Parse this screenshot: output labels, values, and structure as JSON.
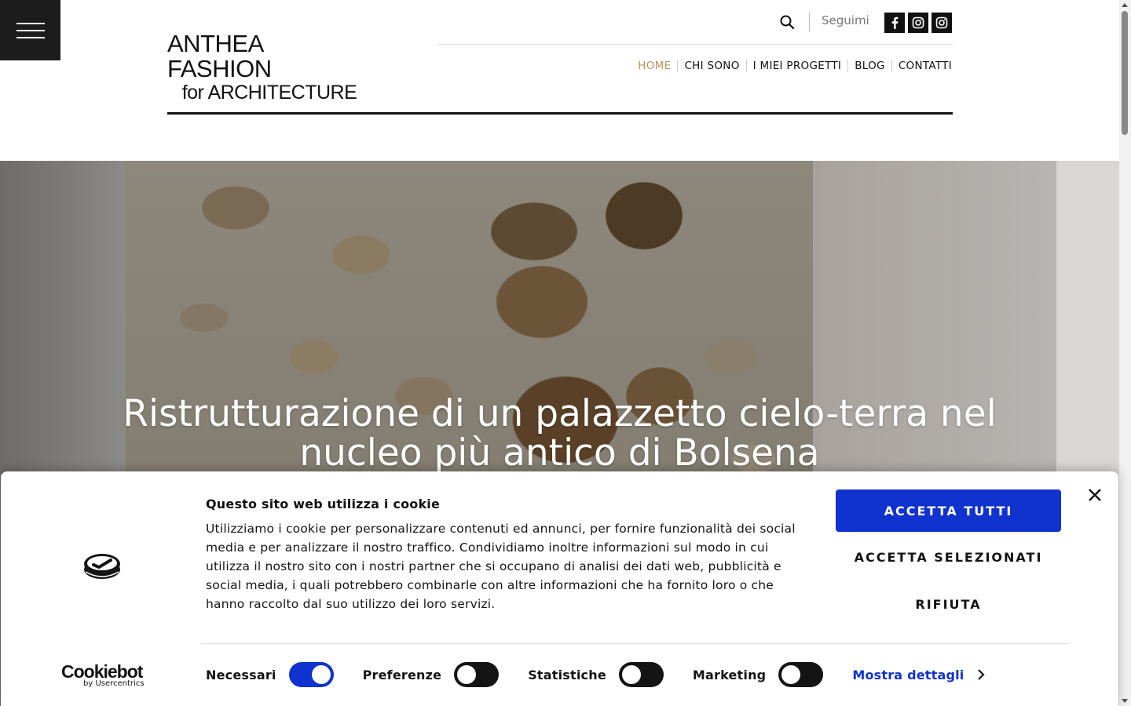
{
  "header": {
    "logo_line1": "ANTHEA FASHION",
    "logo_line2": "for ARCHITECTURE",
    "follow_label": "Seguimi",
    "social": [
      "facebook-icon",
      "instagram-icon",
      "instagram-icon"
    ],
    "nav": [
      {
        "label": "HOME",
        "active": true
      },
      {
        "label": "CHI SONO",
        "active": false
      },
      {
        "label": "I MIEI PROGETTI",
        "active": false
      },
      {
        "label": "BLOG",
        "active": false
      },
      {
        "label": "CONTATTI",
        "active": false
      }
    ],
    "accent_color": "#b39560"
  },
  "hero": {
    "title": "Ristrutturazione di un palazzetto cielo-terra nel nucleo più antico di Bolsena"
  },
  "cookie_banner": {
    "title": "Questo sito web utilizza i cookie",
    "text": "Utilizziamo i cookie per personalizzare contenuti ed annunci, per fornire funzionalità dei social media e per analizzare il nostro traffico. Condividiamo inoltre informazioni sul modo in cui utilizza il nostro sito con i nostri partner che si occupano di analisi dei dati web, pubblicità e social media, i quali potrebbero combinarle con altre informazioni che ha fornito loro o che hanno raccolto dal suo utilizzo dei loro servizi.",
    "accept_all": "ACCETTA TUTTI",
    "accept_selected": "ACCETTA SELEZIONATI",
    "reject": "RIFIUTA",
    "toggles": [
      {
        "label": "Necessari",
        "on": true
      },
      {
        "label": "Preferenze",
        "on": false
      },
      {
        "label": "Statistiche",
        "on": false
      },
      {
        "label": "Marketing",
        "on": false
      }
    ],
    "show_details": "Mostra dettagli",
    "brand_name": "Cookiebot",
    "brand_by": "by Usercentrics",
    "primary_color": "#1032cf"
  }
}
